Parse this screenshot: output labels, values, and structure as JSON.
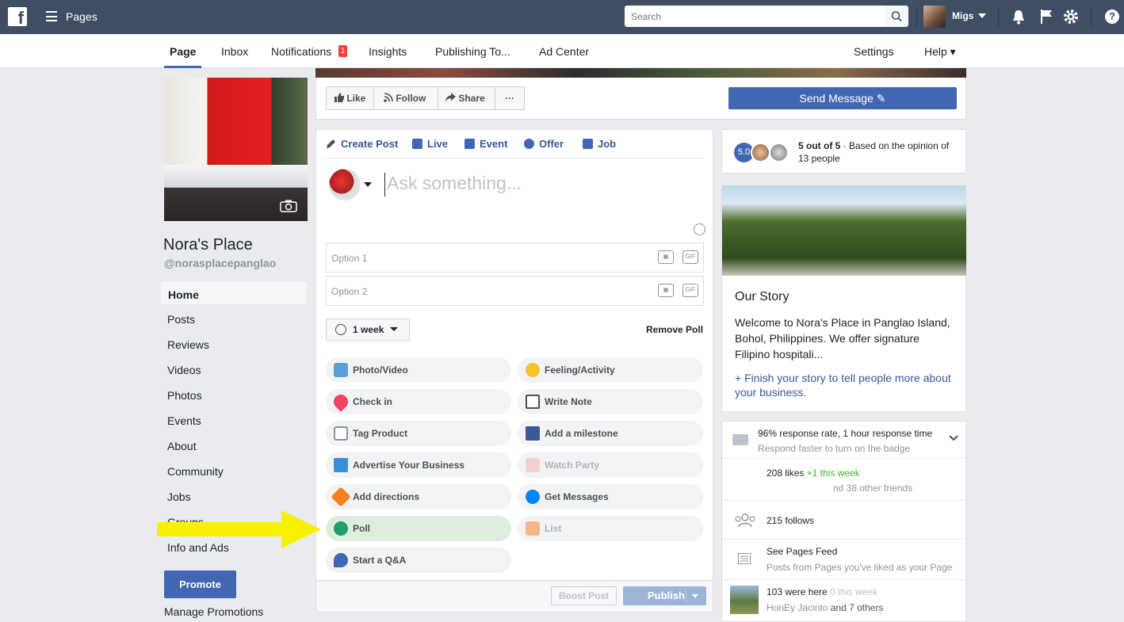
{
  "topbar": {
    "title": "Pages",
    "search_placeholder": "Search",
    "username": "Migs"
  },
  "subnav": {
    "tabs": [
      "Page",
      "Inbox",
      "Notifications",
      "Insights",
      "Publishing To...",
      "Ad Center"
    ],
    "notif_count": "1",
    "settings": "Settings",
    "help": "Help ▾"
  },
  "page": {
    "name": "Nora's Place",
    "handle": "@norasplacepanglao",
    "nav": [
      "Home",
      "Posts",
      "Reviews",
      "Videos",
      "Photos",
      "Events",
      "About",
      "Community",
      "Jobs",
      "Groups",
      "Info and Ads"
    ],
    "promote": "Promote",
    "manage": "Manage Promotions"
  },
  "actions": {
    "like": "Like",
    "follow": "Follow",
    "share": "Share",
    "more": "···",
    "send_message": "Send Message"
  },
  "composer": {
    "tabs": [
      "Create Post",
      "Live",
      "Event",
      "Offer",
      "Job"
    ],
    "placeholder": "Ask something...",
    "option1": "Option 1",
    "option2": "Option 2",
    "gif": "GIF",
    "duration": "1 week",
    "remove_poll": "Remove Poll",
    "pills": [
      "Photo/Video",
      "Feeling/Activity",
      "Check in",
      "Write Note",
      "Tag Product",
      "Add a milestone",
      "Advertise Your Business",
      "Watch Party",
      "Add directions",
      "Get Messages",
      "Poll",
      "List",
      "Start a Q&A"
    ],
    "boost": "Boost Post",
    "publish": "Publish"
  },
  "rating": {
    "score": "5.0",
    "strong": "5 out of 5",
    "text": " · Based on the opinion of 13 people"
  },
  "story": {
    "title": "Our Story",
    "body": "Welcome to Nora's Place in Panglao Island, Bohol, Philippines. We offer signature Filipino hospitali...",
    "link": "+ Finish your story to tell people more about your business."
  },
  "info": {
    "response": "96% response rate, 1 hour response time",
    "response_sub": "Respond faster to turn on the badge",
    "likes": "208 likes",
    "likes_delta": "+1 this week",
    "likes_sub": "nd 38 other friends",
    "follows": "215 follows",
    "feed": "See Pages Feed",
    "feed_sub": "Posts from Pages you've liked as your Page",
    "here": "103 were here",
    "here_delta": "0 this week",
    "here_name": "HonEy Jacinto",
    "here_rest": "and 7 others"
  },
  "colors": {
    "topbar": "#3f4e63",
    "accent": "#4267b2",
    "arrow": "#f8f200"
  }
}
